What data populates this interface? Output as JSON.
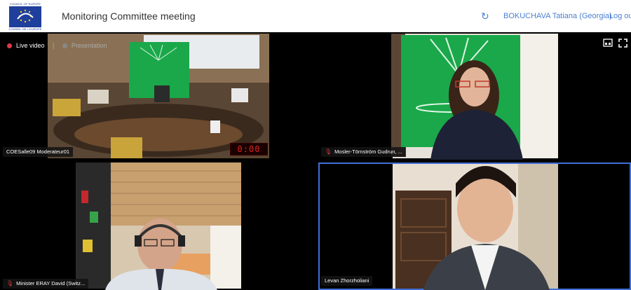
{
  "header": {
    "logo_top": "COUNCIL OF EUROPE",
    "logo_bottom": "CONSEIL DE L'EUROPE",
    "title": "Monitoring Committee meeting",
    "refresh_icon": "refresh-icon",
    "user": "BOKUCHAVA Tatiana (Georgia)",
    "logout": "Log out"
  },
  "toggle": {
    "live_label": "Live video",
    "presentation_label": "Presentation"
  },
  "toolbar": {
    "layout_icon": "grid-layout-icon",
    "fullscreen_icon": "fullscreen-icon"
  },
  "tiles": [
    {
      "name": "COESalle09 Moderateur01",
      "timer": "0:00",
      "muted": false
    },
    {
      "name": "Mosler-Törnström Gudrun, ...",
      "muted": true
    },
    {
      "name": "Minister ERAY David (Switz...",
      "muted": true
    },
    {
      "name": "Levan Zhorzholiani",
      "muted": false,
      "active": true
    }
  ],
  "colors": {
    "accent": "#4a7fd1",
    "live_dot": "#e03a45",
    "muted_icon": "#d23a3a",
    "active_outline": "#3f6fd8",
    "banner_green": "#1aa84a"
  }
}
